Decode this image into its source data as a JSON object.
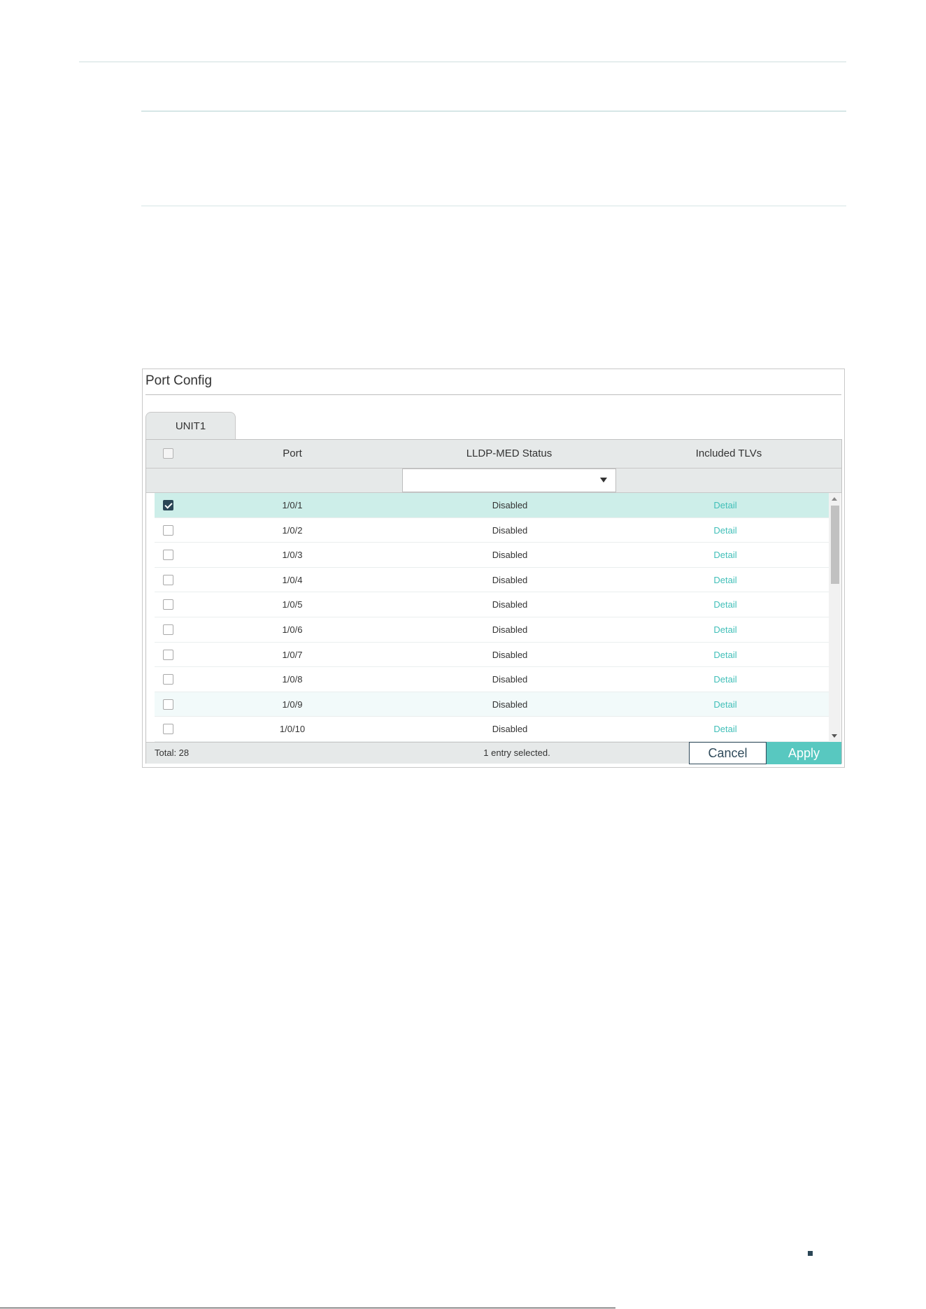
{
  "panel": {
    "title": "Port Config",
    "tab": "UNIT1",
    "columns": {
      "port": "Port",
      "status": "LLDP-MED Status",
      "tlvs": "Included TLVs"
    },
    "rows": [
      {
        "port": "1/0/1",
        "status": "Disabled",
        "detail": "Detail",
        "checked": true
      },
      {
        "port": "1/0/2",
        "status": "Disabled",
        "detail": "Detail",
        "checked": false
      },
      {
        "port": "1/0/3",
        "status": "Disabled",
        "detail": "Detail",
        "checked": false
      },
      {
        "port": "1/0/4",
        "status": "Disabled",
        "detail": "Detail",
        "checked": false
      },
      {
        "port": "1/0/5",
        "status": "Disabled",
        "detail": "Detail",
        "checked": false
      },
      {
        "port": "1/0/6",
        "status": "Disabled",
        "detail": "Detail",
        "checked": false
      },
      {
        "port": "1/0/7",
        "status": "Disabled",
        "detail": "Detail",
        "checked": false
      },
      {
        "port": "1/0/8",
        "status": "Disabled",
        "detail": "Detail",
        "checked": false
      },
      {
        "port": "1/0/9",
        "status": "Disabled",
        "detail": "Detail",
        "checked": false
      },
      {
        "port": "1/0/10",
        "status": "Disabled",
        "detail": "Detail",
        "checked": false
      }
    ],
    "footer": {
      "total": "Total: 28",
      "selection": "1 entry selected.",
      "cancel": "Cancel",
      "apply": "Apply"
    }
  },
  "colors": {
    "accent": "#58c8c0",
    "link": "#40bfb8",
    "selected_row": "#cdeee9",
    "dark": "#2b4656"
  }
}
